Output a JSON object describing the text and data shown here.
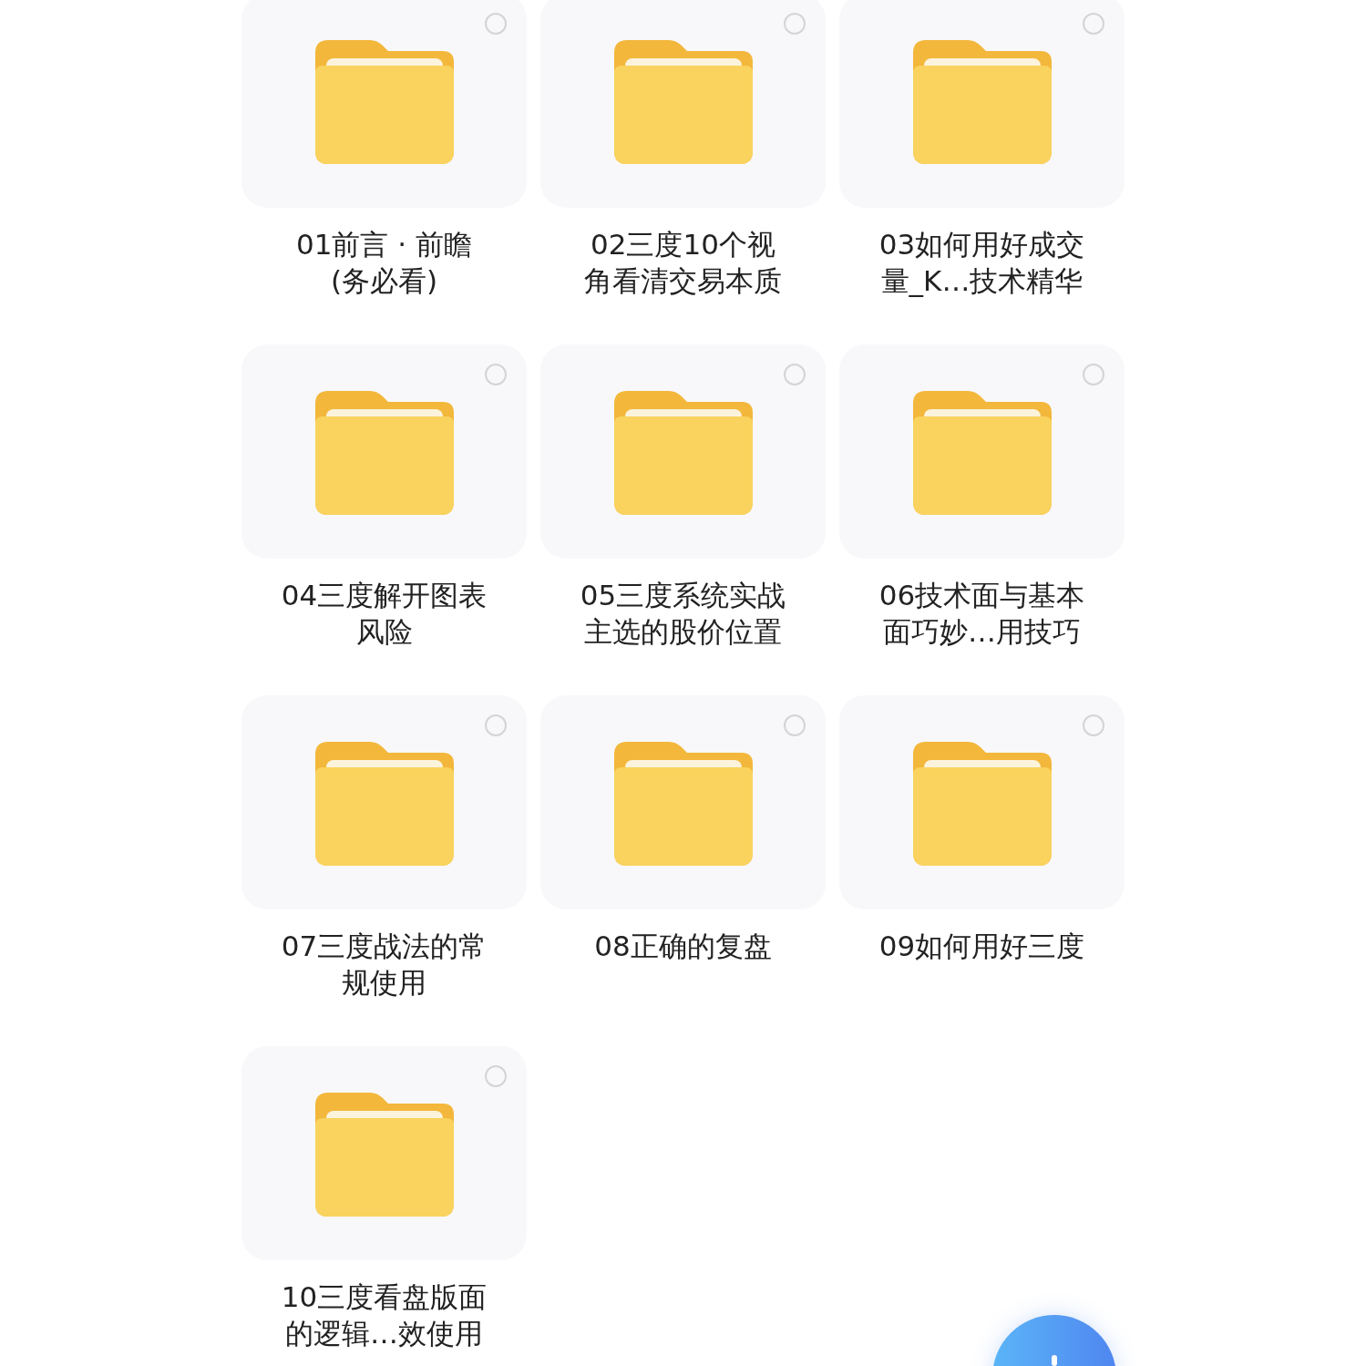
{
  "folders": [
    {
      "name_lines": [
        "01前言 · 前瞻",
        "(务必看)"
      ],
      "selected": false
    },
    {
      "name_lines": [
        "02三度10个视",
        "角看清交易本质"
      ],
      "selected": false
    },
    {
      "name_lines": [
        "03如何用好成交",
        "量_K…技术精华"
      ],
      "selected": false
    },
    {
      "name_lines": [
        "04三度解开图表",
        "风险"
      ],
      "selected": false
    },
    {
      "name_lines": [
        "05三度系统实战",
        "主选的股价位置"
      ],
      "selected": false
    },
    {
      "name_lines": [
        "06技术面与基本",
        "面巧妙…用技巧"
      ],
      "selected": false
    },
    {
      "name_lines": [
        "07三度战法的常",
        "规使用"
      ],
      "selected": false
    },
    {
      "name_lines": [
        "08正确的复盘"
      ],
      "selected": false
    },
    {
      "name_lines": [
        "09如何用好三度"
      ],
      "selected": false
    },
    {
      "name_lines": [
        "10三度看盘版面",
        "的逻辑…效使用"
      ],
      "selected": false
    }
  ]
}
